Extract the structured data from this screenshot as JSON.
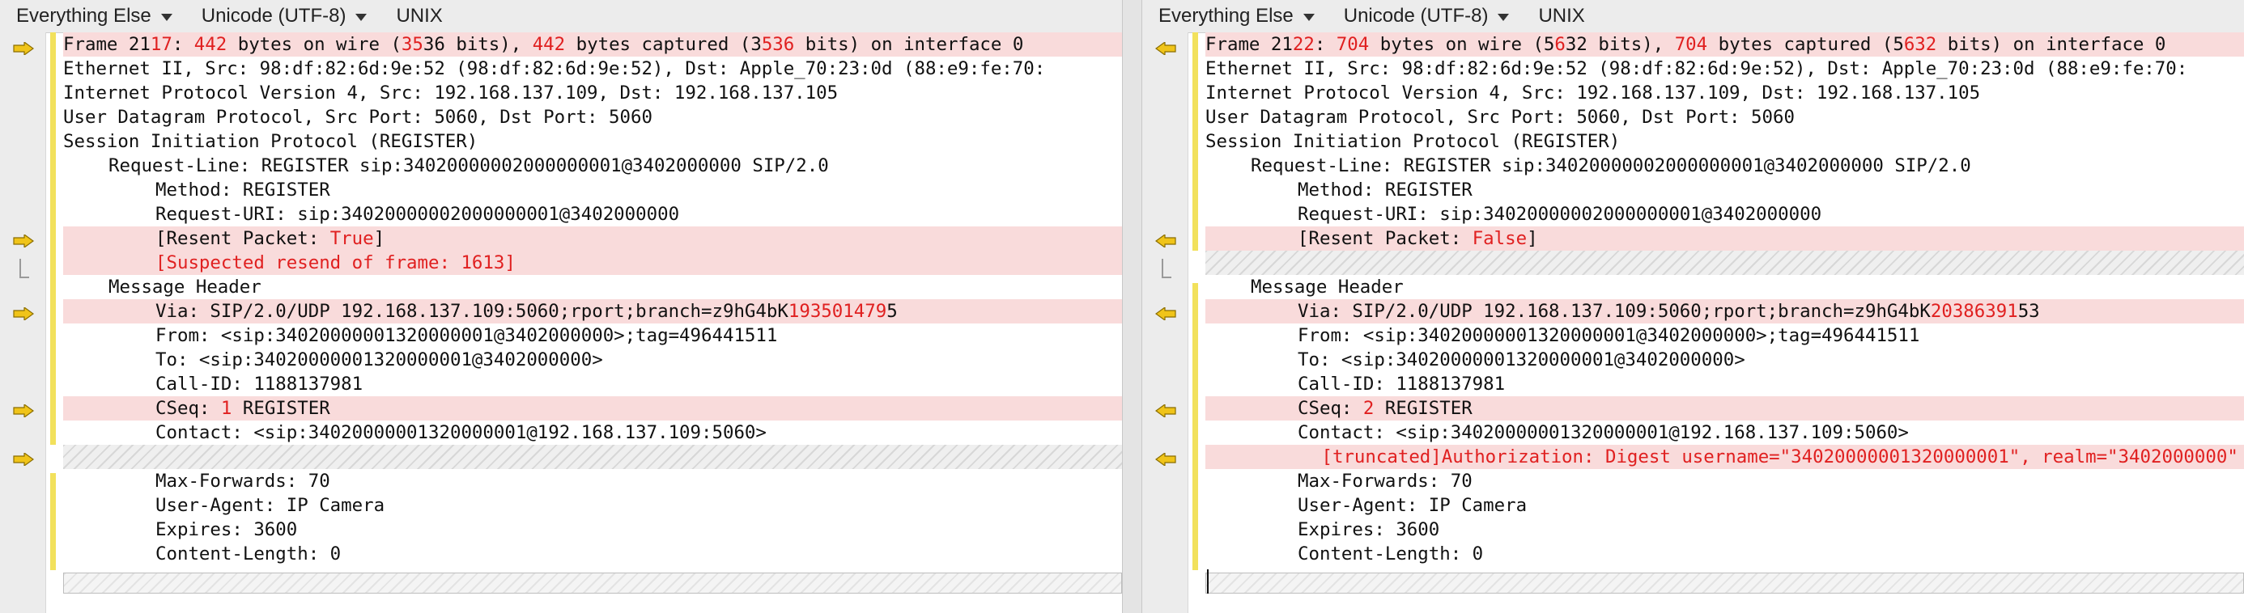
{
  "toolbar": {
    "left": {
      "mode": "Everything Else",
      "encoding": "Unicode (UTF-8)",
      "line_endings": "UNIX"
    },
    "right": {
      "mode": "Everything Else",
      "encoding": "Unicode (UTF-8)",
      "line_endings": "UNIX"
    }
  },
  "left": {
    "frame_prefix": "Frame 21",
    "frame_num_diff": "17",
    "frame_colon": ": ",
    "wire_bytes": "442",
    "frame_mid1": " bytes on wire (",
    "bits_pre": "35",
    "bits_diff": "36",
    "frame_mid2": " bits), ",
    "captured_bytes": "442",
    "frame_mid3": " bytes captured (",
    "cap_bits_pre": "3",
    "cap_bits_diff": "536",
    "frame_suffix": " bits) on interface 0",
    "ethernet": "Ethernet II, Src: 98:df:82:6d:9e:52 (98:df:82:6d:9e:52), Dst: Apple_70:23:0d (88:e9:fe:70:",
    "ip": "Internet Protocol Version 4, Src: 192.168.137.109, Dst: 192.168.137.105",
    "udp": "User Datagram Protocol, Src Port: 5060, Dst Port: 5060",
    "sip": "Session Initiation Protocol (REGISTER)",
    "request_line": "Request-Line: REGISTER sip:34020000002000000001@3402000000 SIP/2.0",
    "method": "Method: REGISTER",
    "request_uri": "Request-URI: sip:34020000002000000001@3402000000",
    "resent_prefix": "[Resent Packet: ",
    "resent_value": "True",
    "resent_suffix": "]",
    "suspected": "[Suspected resend of frame: 1613]",
    "msg_header": "Message Header",
    "via_prefix": "Via: SIP/2.0/UDP 192.168.137.109:5060;rport;branch=z9hG4bK",
    "via_diff": "193501479",
    "via_suffix": "5",
    "from": "From: <sip:34020000001320000001@3402000000>;tag=496441511",
    "to": "To: <sip:34020000001320000001@3402000000>",
    "call_id": "Call-ID: 1188137981",
    "cseq_prefix": "CSeq: ",
    "cseq_value": "1",
    "cseq_suffix": " REGISTER",
    "contact": "Contact: <sip:34020000001320000001@192.168.137.109:5060>",
    "max_forwards": "Max-Forwards: 70",
    "user_agent": "User-Agent: IP Camera",
    "expires": "Expires: 3600",
    "content_length": "Content-Length: 0"
  },
  "right": {
    "frame_prefix": "Frame 21",
    "frame_num_diff": "22",
    "frame_colon": ": ",
    "wire_bytes": "704",
    "frame_mid1": " bytes on wire (",
    "bits_pre": "5",
    "bits_diff": "6",
    "bits_post": "32",
    "frame_mid2": " bits), ",
    "captured_bytes": "704",
    "frame_mid3": " bytes captured (",
    "cap_bits_pre": "5",
    "cap_bits_diff": "632",
    "frame_suffix": " bits) on interface 0",
    "ethernet": "Ethernet II, Src: 98:df:82:6d:9e:52 (98:df:82:6d:9e:52), Dst: Apple_70:23:0d (88:e9:fe:70:",
    "ip": "Internet Protocol Version 4, Src: 192.168.137.109, Dst: 192.168.137.105",
    "udp": "User Datagram Protocol, Src Port: 5060, Dst Port: 5060",
    "sip": "Session Initiation Protocol (REGISTER)",
    "request_line": "Request-Line: REGISTER sip:34020000002000000001@3402000000 SIP/2.0",
    "method": "Method: REGISTER",
    "request_uri": "Request-URI: sip:34020000002000000001@3402000000",
    "resent_prefix": "[Resent Packet: ",
    "resent_value": "False",
    "resent_suffix": "]",
    "msg_header": "Message Header",
    "via_prefix": "Via: SIP/2.0/UDP 192.168.137.109:5060;rport;branch=z9hG4bK",
    "via_diff": "20386391",
    "via_suffix": "53",
    "from": "From: <sip:34020000001320000001@3402000000>;tag=496441511",
    "to": "To: <sip:34020000001320000001@3402000000>",
    "call_id": "Call-ID: 1188137981",
    "cseq_prefix": "CSeq: ",
    "cseq_value": "2",
    "cseq_suffix": " REGISTER",
    "contact": "Contact: <sip:34020000001320000001@192.168.137.109:5060>",
    "authorization": " [truncated]Authorization: Digest username=\"34020000001320000001\", realm=\"3402000000\"",
    "max_forwards": "Max-Forwards: 70",
    "user_agent": "User-Agent: IP Camera",
    "expires": "Expires: 3600",
    "content_length": "Content-Length: 0"
  },
  "colors": {
    "diff_text": "#e02020",
    "diff_bg": "#f9dbdb",
    "change_bar": "#f2e15c",
    "arrow_fill": "#f0c419"
  },
  "icons": {
    "left_marker": "arrow-right-icon",
    "right_marker": "arrow-left-icon",
    "collapse": "bracket-icon"
  }
}
